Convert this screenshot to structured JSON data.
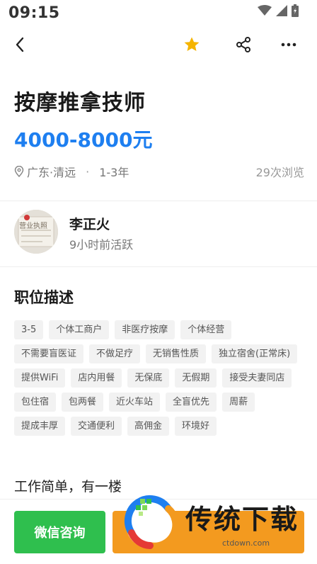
{
  "status_bar": {
    "time": "09:15",
    "icons": [
      "wifi-icon",
      "signal-icon",
      "battery-icon"
    ]
  },
  "nav": {
    "icons": [
      "back-icon",
      "star-icon",
      "share-icon",
      "more-icon"
    ],
    "star_color": "#f5b400"
  },
  "job": {
    "title": "按摩推拿技师",
    "salary": "4000-8000元",
    "salary_color": "#1e7ff0",
    "location": "广东·清远",
    "separator": "·",
    "experience": "1-3年",
    "views": "29次浏览"
  },
  "poster": {
    "avatar_text": "营业执照",
    "name": "李正火",
    "active": "9小时前活跃"
  },
  "description": {
    "section_title": "职位描述",
    "tags": [
      "3-5",
      "个体工商户",
      "非医疗按摩",
      "个体经营",
      "不需要盲医证",
      "不做足疗",
      "无销售性质",
      "独立宿舍(正常床)",
      "提供WiFi",
      "店内用餐",
      "无保底",
      "无假期",
      "接受夫妻同店",
      "包住宿",
      "包两餐",
      "近火车站",
      "全盲优先",
      "周薪",
      "提成丰厚",
      "交通便利",
      "高佣金",
      "环境好"
    ],
    "text": "工作简单，有一楼"
  },
  "actions": {
    "wechat_label": "微信咨询",
    "wechat_color": "#2fbf4e",
    "call_color": "#f39a1f"
  },
  "watermark": {
    "text": "传统下载",
    "sub": "ctdown.com"
  }
}
